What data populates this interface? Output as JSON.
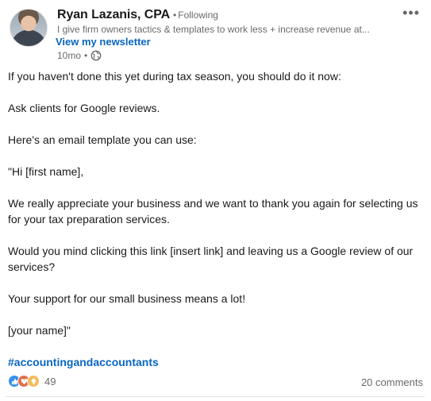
{
  "author": {
    "name": "Ryan Lazanis, CPA",
    "separator": "•",
    "follow_status": "Following",
    "headline": "I give firm owners tactics & templates to work less + increase revenue at...",
    "newsletter_link": "View my newsletter",
    "time_ago": "10mo",
    "meta_separator": "•",
    "visibility_icon": "globe-icon"
  },
  "menu": {
    "more_icon": "more-horizontal-icon",
    "more_label": "•••"
  },
  "post": {
    "paragraphs": [
      "If you haven't done this yet during tax season, you should do it now:",
      "Ask clients for Google reviews.",
      "Here's an email template you can use:",
      "\"Hi [first name],",
      "We really appreciate your business and we want to thank you again for selecting us for your tax preparation services.",
      "Would you mind clicking this link [insert link] and leaving us a Google review of our services?",
      "Your support for our small business means a lot!",
      "[your name]\""
    ],
    "hashtag": "#accountingandaccountants"
  },
  "social": {
    "reaction_icons": [
      "like-icon",
      "love-icon",
      "insightful-icon"
    ],
    "reaction_count": "49",
    "comments": "20 comments"
  },
  "colors": {
    "link": "#0a66c2",
    "like": "#378fe9",
    "love": "#df704d",
    "insightful": "#f5bb5c"
  }
}
